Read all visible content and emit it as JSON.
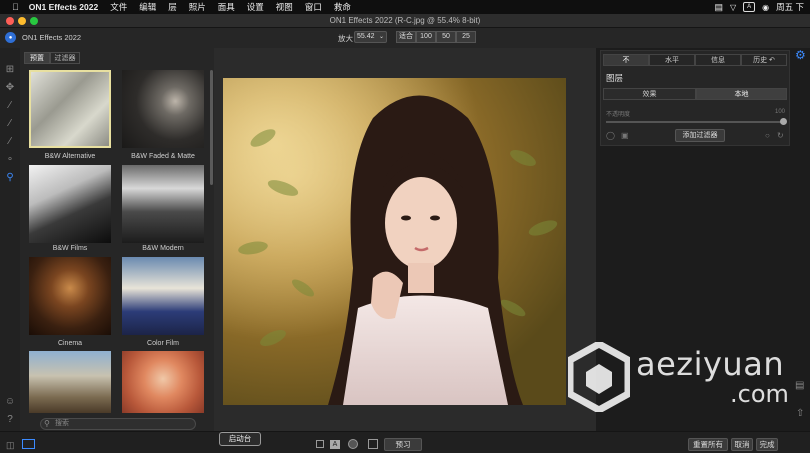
{
  "menubar": {
    "apple": "",
    "app_name": "ON1 Effects 2022",
    "items": [
      "文件",
      "编辑",
      "层",
      "照片",
      "面具",
      "设置",
      "视图",
      "窗口",
      "救命"
    ],
    "input_badge": "A",
    "clock": "周五 下"
  },
  "window": {
    "title": "ON1 Effects 2022 (R-C.jpg @ 55.4% 8-bit)"
  },
  "toolbar": {
    "app_label": "ON1 Effects 2022",
    "zoom_label": "放大",
    "zoom_value": "55.42",
    "fit_label": "适合",
    "zoom_presets": [
      "100",
      "50",
      "25"
    ]
  },
  "browser": {
    "tabs": [
      "预置",
      "过滤器"
    ],
    "presets": [
      {
        "name": "B&W Alternative"
      },
      {
        "name": "B&W Faded & Matte"
      },
      {
        "name": "B&W Films"
      },
      {
        "name": "B&W Modern"
      },
      {
        "name": "Cinema"
      },
      {
        "name": "Color Film"
      }
    ],
    "search_placeholder": "搜索"
  },
  "right_panel": {
    "tabs": [
      "不",
      "水平",
      "信息",
      "历史"
    ],
    "section_title": "图层",
    "subtabs": [
      "效果",
      "本地"
    ],
    "opacity_label": "不透明度",
    "opacity_value": "100",
    "add_filter_label": "添加过滤器"
  },
  "bottom": {
    "launch_label": "启动台",
    "preview_label": "预习",
    "reset_all_label": "重置所有",
    "cancel_label": "取消",
    "done_label": "完成"
  },
  "watermark": {
    "line1": "aeziyuan",
    "line2": ".com"
  },
  "colors": {
    "accent": "#2f6fd6",
    "selected_border": "#e8e0a0",
    "close": "#ff5f57",
    "minimize": "#febc2e",
    "maximize": "#28c840"
  }
}
